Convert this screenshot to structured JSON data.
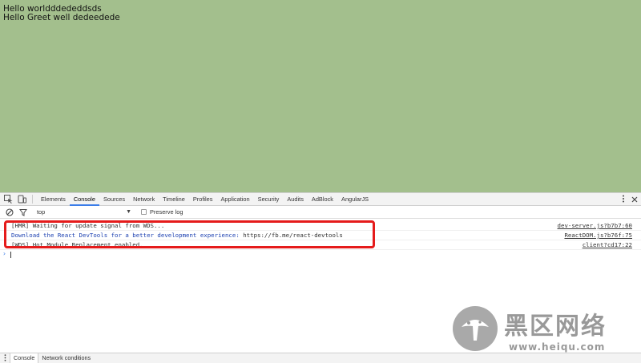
{
  "page": {
    "lines": [
      "Hello worldddededdsds",
      "Hello Greet well dedeedede"
    ],
    "background": "#a3bf8d"
  },
  "devtools": {
    "tabs": [
      "Elements",
      "Console",
      "Sources",
      "Network",
      "Timeline",
      "Profiles",
      "Application",
      "Security",
      "Audits",
      "AdBlock",
      "AngularJS"
    ],
    "active_tab": "Console",
    "context": "top",
    "preserve_log_label": "Preserve log",
    "accent": "#3b7de9",
    "highlight_color": "#e51b1b",
    "messages": [
      {
        "text": "[HMR] Waiting for update signal from WDS...",
        "source": "dev-server.js?b7b7:60"
      },
      {
        "lead": "Download the React DevTools for a better development experience:",
        "url": "https://fb.me/react-devtools",
        "source": "ReactDOM.js?b76f:75"
      },
      {
        "text": "[WDS] Hot Module Replacement enabled.",
        "source": "client?cd17:22"
      }
    ],
    "prompt": "›",
    "drawer_tabs": [
      "Console",
      "Network conditions"
    ],
    "drawer_active": "Console"
  },
  "watermark": {
    "title": "黑区网络",
    "url": "www.heiqu.com"
  }
}
